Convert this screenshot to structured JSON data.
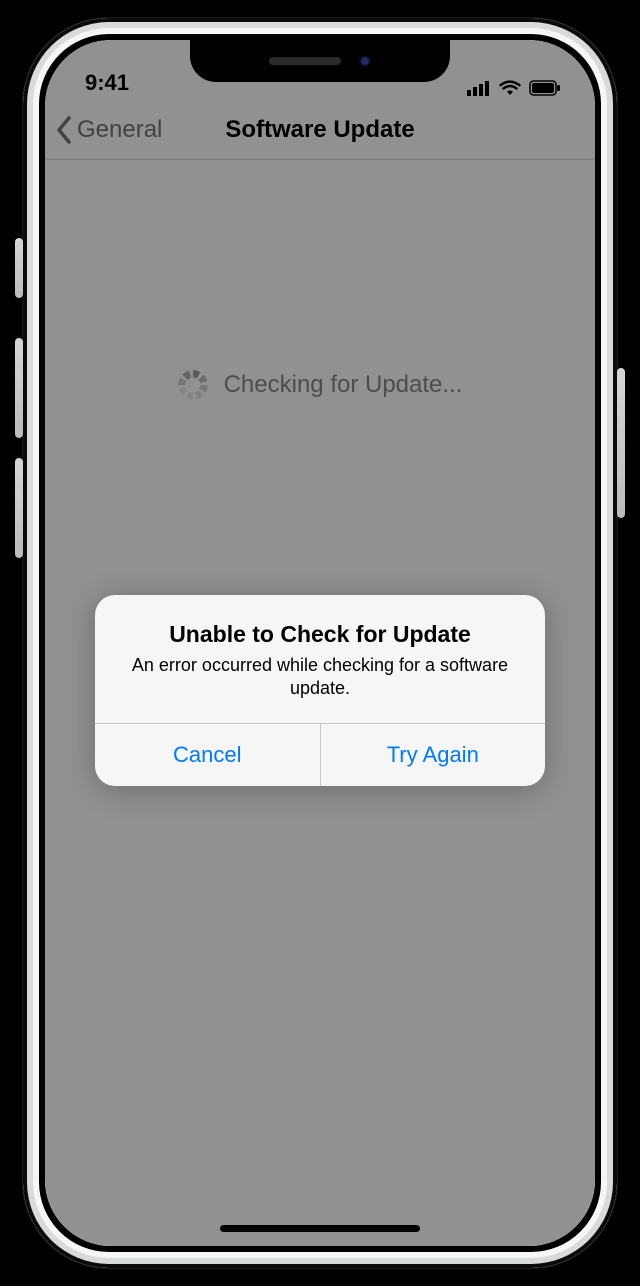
{
  "statusbar": {
    "time": "9:41"
  },
  "nav": {
    "back_label": "General",
    "title": "Software Update"
  },
  "body": {
    "checking_text": "Checking for Update..."
  },
  "alert": {
    "title": "Unable to Check for Update",
    "message": "An error occurred while checking for a software update.",
    "cancel_label": "Cancel",
    "retry_label": "Try Again"
  }
}
